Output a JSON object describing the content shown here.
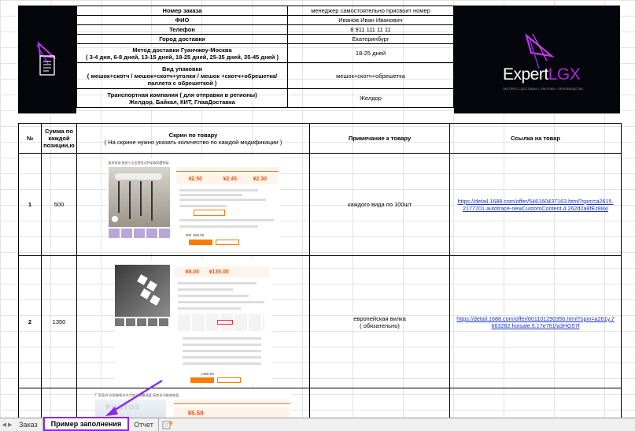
{
  "order_info": [
    {
      "key": "Номер заказа",
      "sub": "",
      "value": "менеджер самостоятельно присвоит номер"
    },
    {
      "key": "ФИО",
      "sub": "",
      "value": "Иванов Иван Иванович"
    },
    {
      "key": "Телефон",
      "sub": "",
      "value": "8 911 111 11 11"
    },
    {
      "key": "Город доставки",
      "sub": "",
      "value": "Екатеринбург"
    },
    {
      "key": "Метод доставки Гуанчжоу-Москва",
      "sub": "( 3-4 дня, 6-8 дней, 13-15 дней, 18-25 дней, 25-35 дней, 35-45 дней )",
      "value": "18-25 дней"
    },
    {
      "key": "Вид упаковки",
      "sub": "( мешок+скотч / мешок+скотч+уголки / мешок +скотч+обрешетка/ паллета с обрешеткой )",
      "value": "мешок+скотч+обрешетка"
    },
    {
      "key": "Транспортная компания ( для отправки в регионы)",
      "sub": "Желдор, Байкал, КИТ, ГлавДоставка",
      "value": "Желдор"
    }
  ],
  "brand": {
    "name_part1": "Expert",
    "name_part2": "LGX",
    "tagline": "ЭКСПРЕСС ДОСТАВКА • ЗАКУПКИ • ПРОИЗВОДСТВО",
    "accent": "#b126d9",
    "bg": "#05050c"
  },
  "table": {
    "headers": {
      "num": "№",
      "sum": "Сумма по каждой позиции,ю",
      "screen": "Скрин по товару",
      "screen_sub": "( На скрине нужно указать количество по каждой модификации )",
      "note": "Примечание к товару",
      "link": "Ссылка на товар"
    },
    "rows": [
      {
        "num": "1",
        "sum": "500",
        "note": "каждого вида по 100шт",
        "link": "https://detail.1688.com/offer/546160437163.html?spm=a2615.2177701.autotrace-newCustomContent.4.262d2a8fEz88xi"
      },
      {
        "num": "2",
        "sum": "1350",
        "note": "европейская вилка\n( обязательно)",
        "link": "https://detail.1688.com/offer/601101290356.html?spm=a261y.7663282.hotsale.5.17e761fa3HG57f"
      },
      {
        "num": "",
        "sum": "",
        "note": "",
        "link": ""
      }
    ]
  },
  "screens": {
    "row1": {
      "title": "厨房收纳 厨房小五金壁挂式杯架收纳置物架",
      "prices": [
        "¥2.50",
        "¥2.45",
        "¥2.30"
      ],
      "qty_a": "200",
      "qty_b": "500.00"
    },
    "row2": {
      "prices": [
        "¥8.00",
        "¥135.00"
      ],
      "total": "1350.00"
    },
    "row3": {
      "title": "厂家直供 抗原偏角浴巾刀叉分隔整理篮 厨房多功能收纳篮",
      "price": "¥6.50",
      "watermark": "PHOTOS"
    }
  },
  "tabs": [
    {
      "label": "Заказ",
      "active": false
    },
    {
      "label": "Пример заполнения",
      "active": true
    },
    {
      "label": "Отчет",
      "active": false
    }
  ],
  "colors": {
    "active_tab_border": "#8b2be2",
    "link": "#1a35c8",
    "price": "#ff4d00"
  }
}
